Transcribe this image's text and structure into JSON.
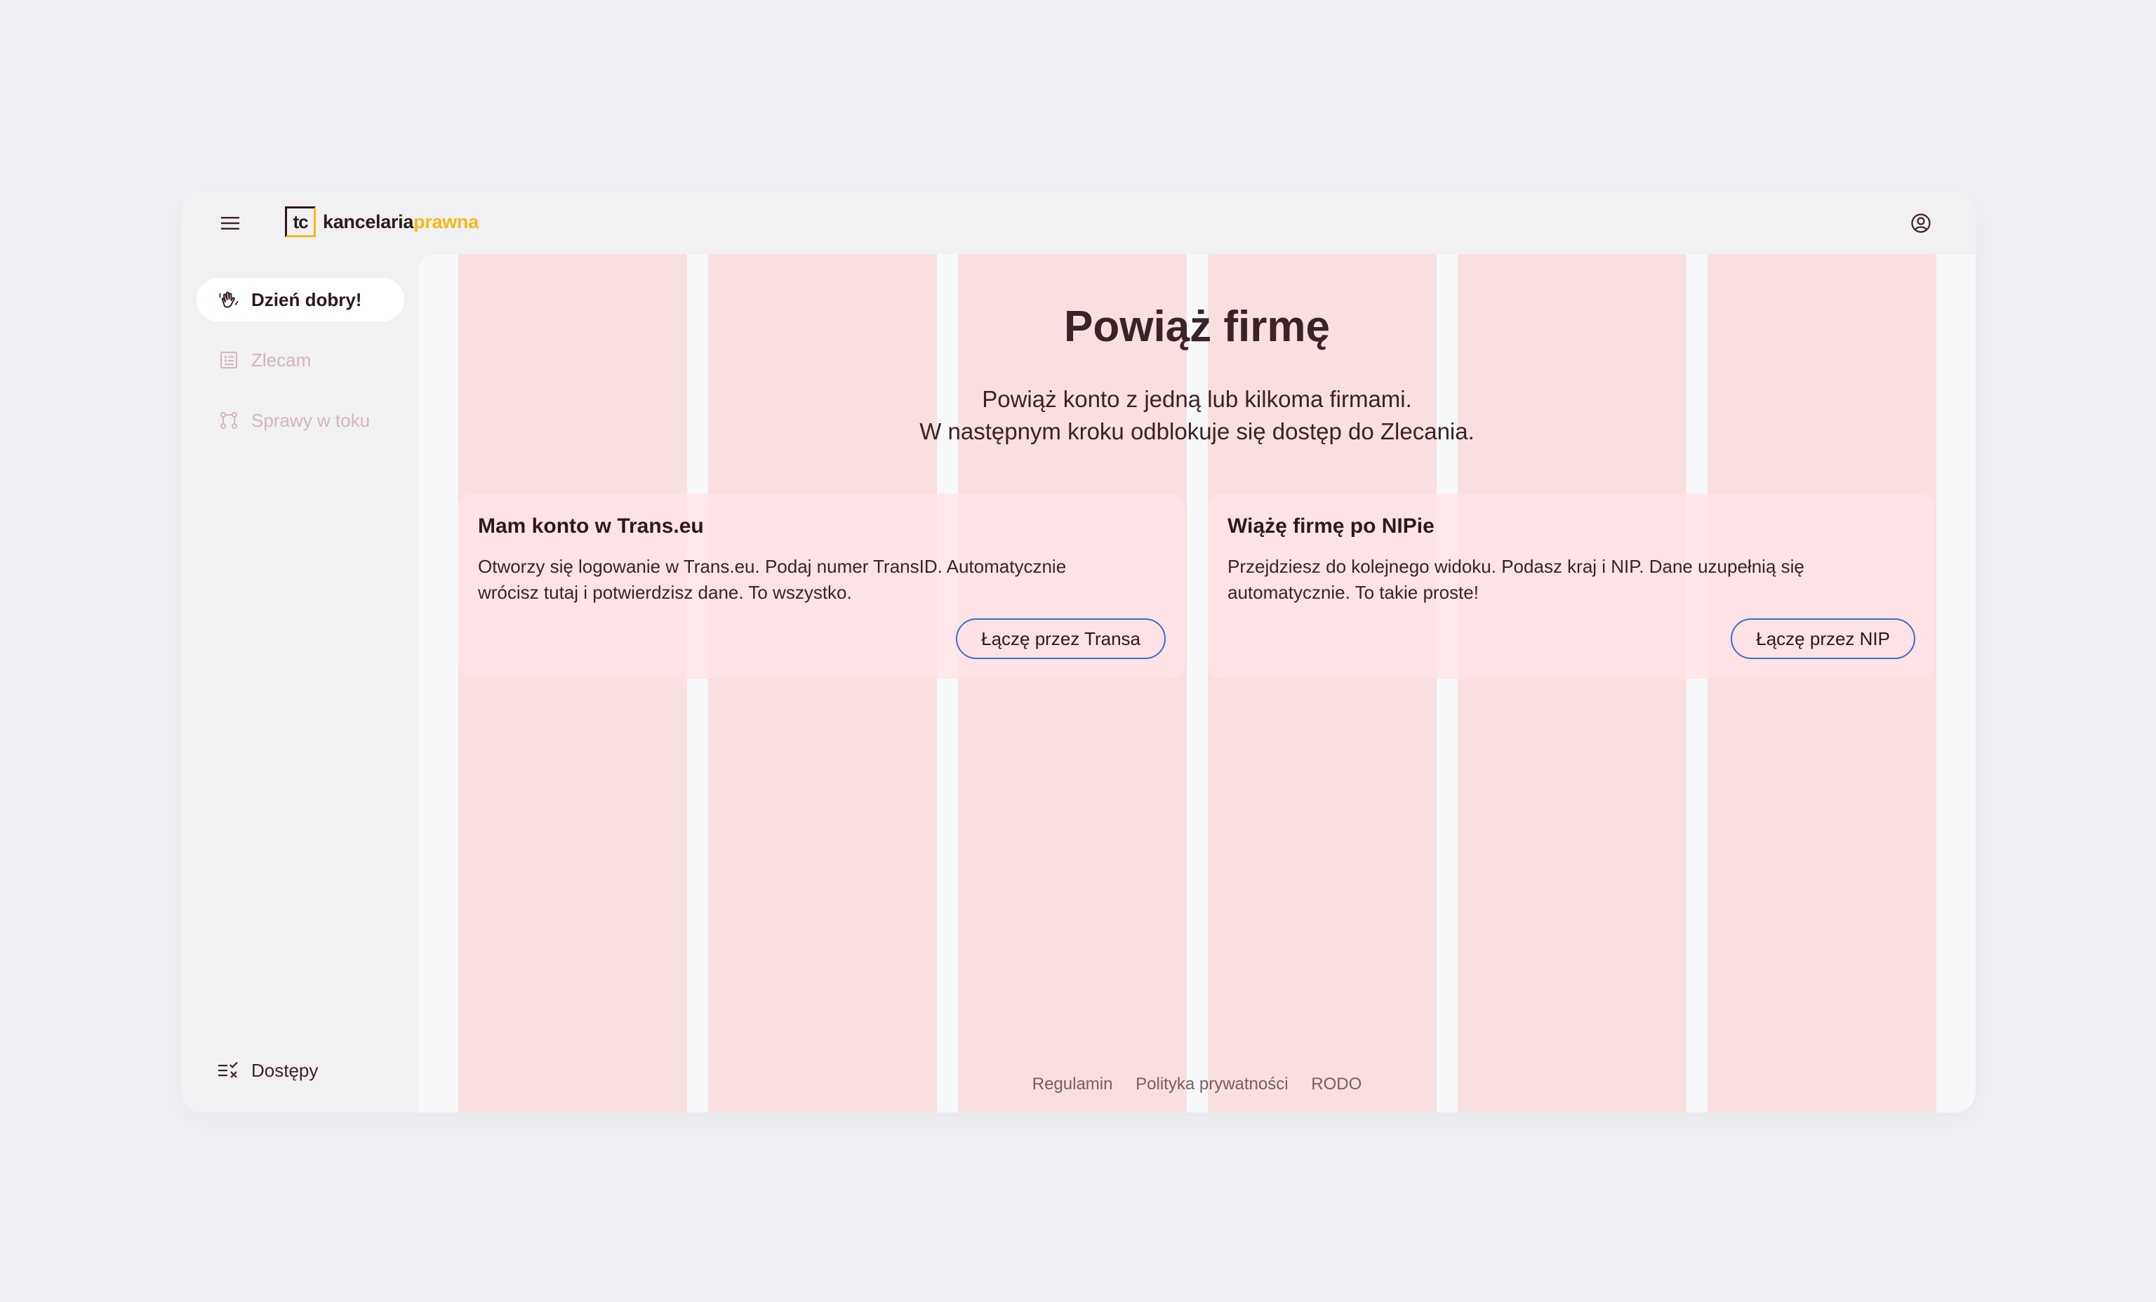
{
  "app": {
    "logo_mark": "tc",
    "logo_text_main": "kancelaria",
    "logo_text_accent": "prawna"
  },
  "colors": {
    "accent": "#f6b81a",
    "text": "#3a2326",
    "button_border": "#3b6fc9",
    "stripe": "#f8dfe0"
  },
  "sidebar": {
    "items": [
      {
        "label": "Dzień dobry!",
        "icon": "waving-hand-icon",
        "state": "active"
      },
      {
        "label": "Zlecam",
        "icon": "clipboard-list-icon",
        "state": "disabled"
      },
      {
        "label": "Sprawy w toku",
        "icon": "workflow-icon",
        "state": "disabled"
      }
    ],
    "bottom_item": {
      "label": "Dostępy",
      "icon": "list-check-icon"
    }
  },
  "main": {
    "title": "Powiąż firmę",
    "subtitle_line1": "Powiąż konto z jedną lub kilkoma firmami.",
    "subtitle_line2": "W następnym kroku odblokuje się dostęp do Zlecania.",
    "cards": [
      {
        "title": "Mam konto w Trans.eu",
        "description": "Otworzy się logowanie w Trans.eu. Podaj numer TransID. Automatycznie wrócisz tutaj i potwierdzisz dane. To wszystko.",
        "button": "Łączę przez Transa"
      },
      {
        "title": "Wiążę firmę po NIPie",
        "description": "Przejdziesz do kolejnego widoku. Podasz kraj i NIP. Dane uzupełnią się automatycznie. To takie proste!",
        "button": "Łączę przez NIP"
      }
    ]
  },
  "footer": {
    "links": [
      "Regulamin",
      "Polityka prywatności",
      "RODO"
    ]
  }
}
